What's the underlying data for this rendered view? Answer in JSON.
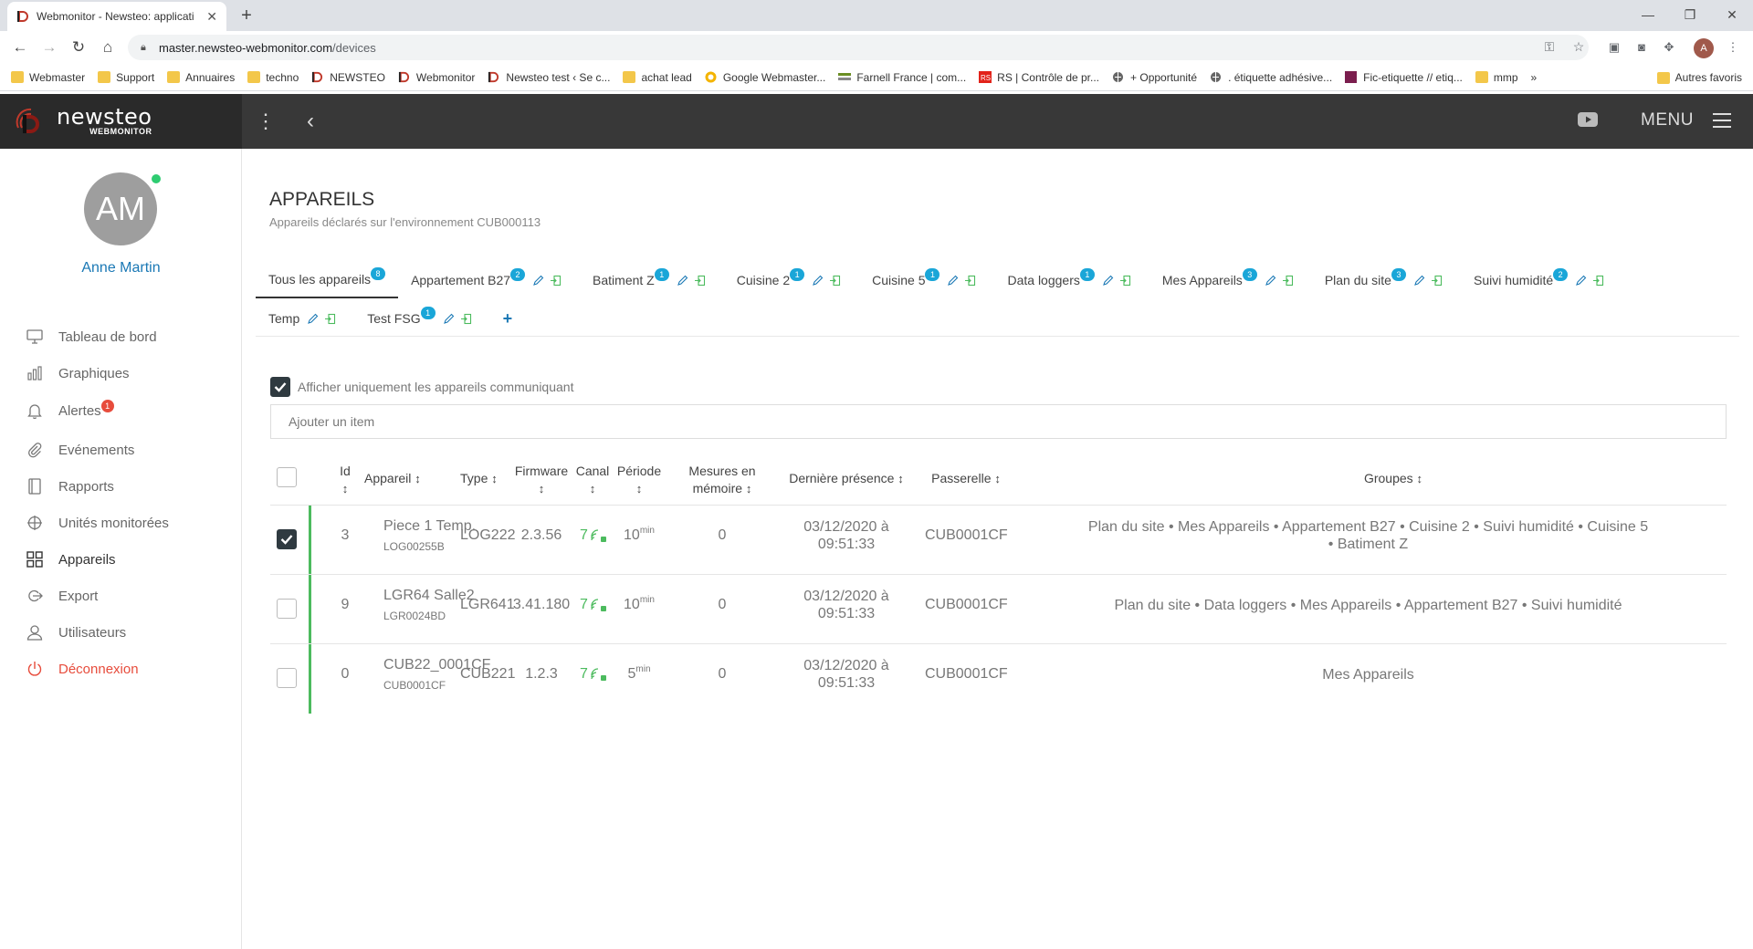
{
  "browser": {
    "tab_title": "Webmonitor - Newsteo: applicati",
    "url_host": "master.newsteo-webmonitor.com",
    "url_path": "/devices",
    "profile_initial": "A",
    "bookmarks": [
      {
        "label": "Webmaster",
        "icon": "folder"
      },
      {
        "label": "Support",
        "icon": "folder"
      },
      {
        "label": "Annuaires",
        "icon": "folder"
      },
      {
        "label": "techno",
        "icon": "folder"
      },
      {
        "label": "NEWSTEO",
        "icon": "newsteo"
      },
      {
        "label": "Webmonitor",
        "icon": "newsteo"
      },
      {
        "label": "Newsteo test ‹ Se c...",
        "icon": "newsteo"
      },
      {
        "label": "achat lead",
        "icon": "folder"
      },
      {
        "label": "Google Webmaster...",
        "icon": "google"
      },
      {
        "label": "Farnell France | com...",
        "icon": "farnell"
      },
      {
        "label": "RS | Contrôle de pr...",
        "icon": "rs"
      },
      {
        "label": "+ Opportunité",
        "icon": "globe"
      },
      {
        "label": ". étiquette adhésive...",
        "icon": "globe"
      },
      {
        "label": "Fic-etiquette // etiq...",
        "icon": "fic"
      },
      {
        "label": "mmp",
        "icon": "folder"
      }
    ],
    "bookmarks_more": "»",
    "other_bookmarks": "Autres favoris"
  },
  "app": {
    "logo_name": "newsteo",
    "logo_sub": "WEBMONITOR",
    "menu_label": "MENU"
  },
  "sidebar": {
    "avatar_initials": "AM",
    "user_name": "Anne Martin",
    "items": [
      {
        "label": "Tableau de bord",
        "icon": "monitor-icon"
      },
      {
        "label": "Graphiques",
        "icon": "bar-chart-icon"
      },
      {
        "label": "Alertes",
        "icon": "bell-icon",
        "badge": "1"
      },
      {
        "label": "Evénements",
        "icon": "paperclip-icon"
      },
      {
        "label": "Rapports",
        "icon": "report-icon"
      },
      {
        "label": "Unités monitorées",
        "icon": "crosshair-icon"
      },
      {
        "label": "Appareils",
        "icon": "grid-icon"
      },
      {
        "label": "Export",
        "icon": "export-icon"
      },
      {
        "label": "Utilisateurs",
        "icon": "user-icon"
      },
      {
        "label": "Déconnexion",
        "icon": "power-icon"
      }
    ]
  },
  "page": {
    "title": "APPAREILS",
    "subtitle": "Appareils déclarés sur l'environnement CUB000113"
  },
  "tabs_row1": [
    {
      "label": "Tous les appareils",
      "count": "8",
      "active": true,
      "editable": false
    },
    {
      "label": "Appartement B27",
      "count": "2",
      "editable": true
    },
    {
      "label": "Batiment Z",
      "count": "1",
      "editable": true
    },
    {
      "label": "Cuisine 2",
      "count": "1",
      "editable": true
    },
    {
      "label": "Cuisine 5",
      "count": "1",
      "editable": true
    },
    {
      "label": "Data loggers",
      "count": "1",
      "editable": true
    },
    {
      "label": "Mes Appareils",
      "count": "3",
      "editable": true
    },
    {
      "label": "Plan du site",
      "count": "3",
      "editable": true
    },
    {
      "label": "Suivi humidité",
      "count": "2",
      "editable": true
    }
  ],
  "tabs_row2": [
    {
      "label": "Temp",
      "count": "",
      "editable": true
    },
    {
      "label": "Test FSG",
      "count": "1",
      "editable": true
    }
  ],
  "add_tab": "+",
  "filter": {
    "label": "Afficher uniquement les appareils communiquant",
    "checked": true
  },
  "add_item_placeholder": "Ajouter un item",
  "table": {
    "headers": {
      "id": "Id",
      "device": "Appareil",
      "type": "Type",
      "firmware": "Firmware",
      "channel": "Canal",
      "period": "Période",
      "memory_1": "Mesures en",
      "memory_2": "mémoire",
      "last_seen": "Dernière présence",
      "gateway": "Passerelle",
      "groups": "Groupes"
    },
    "sort_glyph": "↕",
    "rows": [
      {
        "checked": true,
        "id": "3",
        "name": "Piece 1 Temp.",
        "serial": "LOG00255B",
        "type": "LOG222",
        "firmware": "2.3.56",
        "channel": "7",
        "period": "10",
        "period_unit": "min",
        "memory": "0",
        "last_seen_1": "03/12/2020 à",
        "last_seen_2": "09:51:33",
        "gateway": "CUB0001CF",
        "groups_1": "Plan du site • Mes Appareils • Appartement B27 • Cuisine 2 • Suivi humidité • Cuisine 5",
        "groups_2": "• Batiment Z"
      },
      {
        "checked": false,
        "id": "9",
        "name": "LGR64 Salle2",
        "serial": "LGR0024BD",
        "type": "LGR641",
        "firmware": "3.41.180",
        "channel": "7",
        "period": "10",
        "period_unit": "min",
        "memory": "0",
        "last_seen_1": "03/12/2020 à",
        "last_seen_2": "09:51:33",
        "gateway": "CUB0001CF",
        "groups_1": "Plan du site • Data loggers • Mes Appareils • Appartement B27 • Suivi humidité",
        "groups_2": ""
      },
      {
        "checked": false,
        "id": "0",
        "name": "CUB22_0001CF",
        "serial": "CUB0001CF",
        "type": "CUB221",
        "firmware": "1.2.3",
        "channel": "7",
        "period": "5",
        "period_unit": "min",
        "memory": "0",
        "last_seen_1": "03/12/2020 à",
        "last_seen_2": "09:51:33",
        "gateway": "CUB0001CF",
        "groups_1": "Mes Appareils",
        "groups_2": ""
      }
    ]
  },
  "colors": {
    "accent_blue": "#1a78b5",
    "badge_cyan": "#1aa6d8",
    "green": "#4cbb5e",
    "red": "#e74c3c",
    "header_dark": "#383838"
  }
}
